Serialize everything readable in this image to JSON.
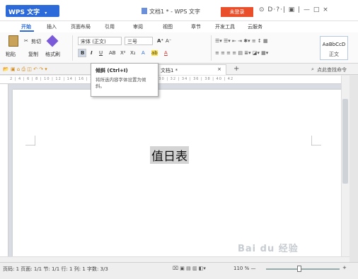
{
  "window": {
    "brand_label": "WPS 文字",
    "brand_dropdown": "▾",
    "doc_title": "文档1 * - WPS 文字",
    "login_label": "未登录",
    "title_icons": "⊙ D·?·| ▣ | — □ ×",
    "accent_color": "#2b6ad8",
    "login_color": "#e94f2b"
  },
  "menu": {
    "tabs": [
      "开始",
      "插入",
      "页面布局",
      "引用",
      "审阅",
      "视图",
      "章节",
      "开发工具",
      "云服务"
    ],
    "active_tab": "开始"
  },
  "ribbon": {
    "cut": "剪切",
    "paste": "粘贴",
    "copy": "复制",
    "format_painter": "格式刷",
    "font_name": "宋体 (正文)",
    "font_size": "三号",
    "bold": "B",
    "italic": "I",
    "underline": "U",
    "abc": "AB",
    "superscript": "X²",
    "subscript": "X₂",
    "grow_font": "A⁺",
    "shrink_font": "A⁻",
    "style_preview": "AaBbCcD",
    "style_name": "正文"
  },
  "quickbar": {
    "doc_tab_label": "文档1 *",
    "close": "×",
    "new_tab": "+",
    "search_label": "点此查找命令"
  },
  "ruler": {
    "ticks": "2 | 4 | 6 | 8 | 10 | 12 | 14 | 16 | 18 | 20 | 22 | 24 | 26 | 28 | 30 | 32 | 34 | 36 | 38 | 40 | 42"
  },
  "document": {
    "heading": "值日表"
  },
  "tooltip": {
    "title": "倾斜 (Ctrl+I)",
    "description": "将所选内容字体设置为倾斜。"
  },
  "status": {
    "page": "页码: 1",
    "pages": "页面: 1/1",
    "section": "节: 1/1",
    "row": "行: 1",
    "column": "列: 1",
    "word_count": "字数: 3/3",
    "zoom": "110 %",
    "zoom_minus": "—",
    "zoom_plus": "+"
  },
  "watermark": "Bai du 经验"
}
